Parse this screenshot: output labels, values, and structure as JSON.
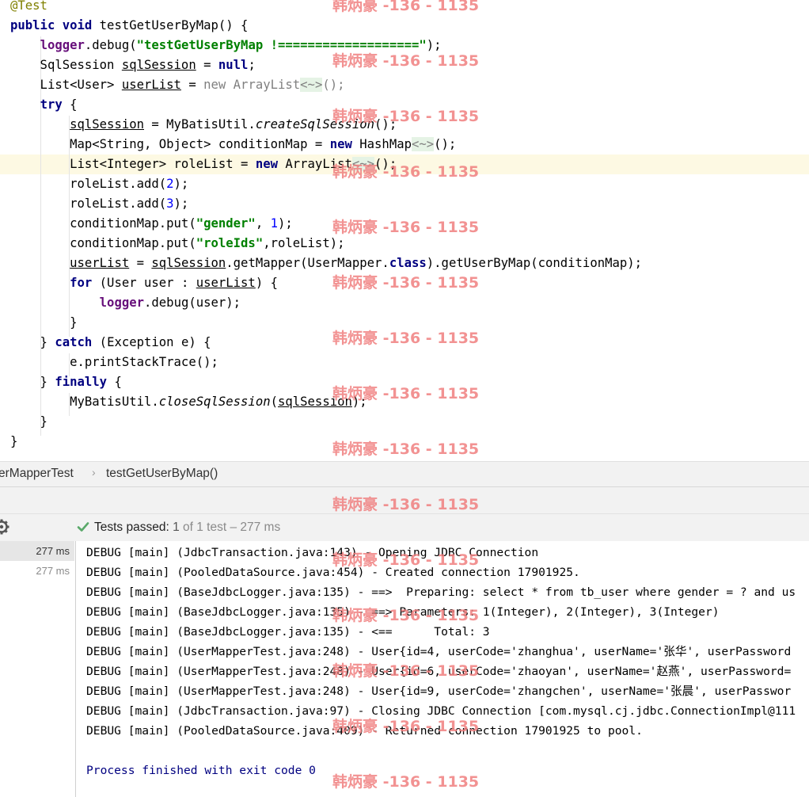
{
  "editor": {
    "lines": [
      [
        {
          "t": "@Test",
          "c": "ann"
        }
      ],
      [
        {
          "t": "public void ",
          "c": "kw"
        },
        {
          "t": "testGetUserByMap() {"
        }
      ],
      [
        {
          "t": "    "
        },
        {
          "t": "logger",
          "c": "fld"
        },
        {
          "t": ".debug("
        },
        {
          "t": "\"testGetUserByMap !===================\"",
          "c": "str"
        },
        {
          "t": ");"
        }
      ],
      [
        {
          "t": "    SqlSession "
        },
        {
          "t": "sqlSession",
          "c": "und"
        },
        {
          "t": " = "
        },
        {
          "t": "null",
          "c": "kw"
        },
        {
          "t": ";"
        }
      ],
      [
        {
          "t": "    List<User> "
        },
        {
          "t": "userList",
          "c": "und"
        },
        {
          "t": " = "
        },
        {
          "t": "new ",
          "c": "gry"
        },
        {
          "t": "ArrayList",
          "c": "gry"
        },
        {
          "t": "<~>",
          "c": "dia"
        },
        {
          "t": "();",
          "c": "gry"
        }
      ],
      [
        {
          "t": "    "
        },
        {
          "t": "try",
          "c": "kw"
        },
        {
          "t": " {"
        }
      ],
      [
        {
          "t": "        "
        },
        {
          "t": "sqlSession",
          "c": "und"
        },
        {
          "t": " = MyBatisUtil."
        },
        {
          "t": "createSqlSession",
          "c": "ita"
        },
        {
          "t": "();"
        }
      ],
      [
        {
          "t": "        Map<String, Object> conditionMap = "
        },
        {
          "t": "new ",
          "c": "kw"
        },
        {
          "t": "HashMap"
        },
        {
          "t": "<~>",
          "c": "dia"
        },
        {
          "t": "();"
        }
      ],
      [
        {
          "t": "        List<Integer> roleList = "
        },
        {
          "t": "new ",
          "c": "kw"
        },
        {
          "t": "ArrayList"
        },
        {
          "t": "<~>",
          "c": "dia"
        },
        {
          "t": "();"
        }
      ],
      [
        {
          "t": "        roleList.add("
        },
        {
          "t": "2",
          "c": "num"
        },
        {
          "t": ");"
        }
      ],
      [
        {
          "t": "        roleList.add("
        },
        {
          "t": "3",
          "c": "num"
        },
        {
          "t": ");"
        }
      ],
      [
        {
          "t": "        conditionMap.put("
        },
        {
          "t": "\"gender\"",
          "c": "str"
        },
        {
          "t": ", "
        },
        {
          "t": "1",
          "c": "num"
        },
        {
          "t": ");"
        }
      ],
      [
        {
          "t": "        conditionMap.put("
        },
        {
          "t": "\"roleIds\"",
          "c": "str"
        },
        {
          "t": ",roleList);"
        }
      ],
      [
        {
          "t": "        "
        },
        {
          "t": "userList",
          "c": "und"
        },
        {
          "t": " = "
        },
        {
          "t": "sqlSession",
          "c": "und"
        },
        {
          "t": ".getMapper(UserMapper."
        },
        {
          "t": "class",
          "c": "kw"
        },
        {
          "t": ").getUserByMap(conditionMap);"
        }
      ],
      [
        {
          "t": "        "
        },
        {
          "t": "for",
          "c": "kw"
        },
        {
          "t": " (User user : "
        },
        {
          "t": "userList",
          "c": "und"
        },
        {
          "t": ") {"
        }
      ],
      [
        {
          "t": "            "
        },
        {
          "t": "logger",
          "c": "fld"
        },
        {
          "t": ".debug(user);"
        }
      ],
      [
        {
          "t": "        }"
        }
      ],
      [
        {
          "t": "    } "
        },
        {
          "t": "catch",
          "c": "kw"
        },
        {
          "t": " (Exception e) {"
        }
      ],
      [
        {
          "t": "        e.printStackTrace();"
        }
      ],
      [
        {
          "t": "    } "
        },
        {
          "t": "finally",
          "c": "kw"
        },
        {
          "t": " {"
        }
      ],
      [
        {
          "t": "        MyBatisUtil."
        },
        {
          "t": "closeSqlSession",
          "c": "ita"
        },
        {
          "t": "("
        },
        {
          "t": "sqlSession",
          "c": "und"
        },
        {
          "t": ");"
        }
      ],
      [
        {
          "t": "    }"
        }
      ],
      [
        {
          "t": "}"
        }
      ]
    ]
  },
  "breadcrumb": {
    "class_name": "erMapperTest",
    "method_name": "testGetUserByMap()"
  },
  "status": {
    "passed_label": "Tests passed: ",
    "passed_count": "1",
    "of_total": " of 1 test – 277 ms"
  },
  "test_tree": {
    "rows": [
      "277 ms",
      "277 ms"
    ]
  },
  "console": {
    "lines": [
      "DEBUG [main] (JdbcTransaction.java:143) - Opening JDBC Connection",
      "DEBUG [main] (PooledDataSource.java:454) - Created connection 17901925.",
      "DEBUG [main] (BaseJdbcLogger.java:135) - ==>  Preparing: select * from tb_user where gender = ? and us",
      "DEBUG [main] (BaseJdbcLogger.java:135) - ==> Parameters: 1(Integer), 2(Integer), 3(Integer)",
      "DEBUG [main] (BaseJdbcLogger.java:135) - <==      Total: 3",
      "DEBUG [main] (UserMapperTest.java:248) - User{id=4, userCode='zhanghua', userName='张华', userPassword",
      "DEBUG [main] (UserMapperTest.java:248) - User{id=6, userCode='zhaoyan', userName='赵燕', userPassword=",
      "DEBUG [main] (UserMapperTest.java:248) - User{id=9, userCode='zhangchen', userName='张晨', userPasswor",
      "DEBUG [main] (JdbcTransaction.java:97) - Closing JDBC Connection [com.mysql.cj.jdbc.ConnectionImpl@111",
      "DEBUG [main] (PooledDataSource.java:409) - Returned connection 17901925 to pool.",
      "",
      "Process finished with exit code 0"
    ]
  },
  "watermark": {
    "text": "韩炳豪 -136 - 1135"
  },
  "colors": {
    "keyword": "#000080",
    "string": "#008000",
    "number": "#0000ff",
    "annotation": "#808000",
    "field": "#660e7a",
    "watermark": "#f07f7f",
    "success": "#59a869"
  }
}
